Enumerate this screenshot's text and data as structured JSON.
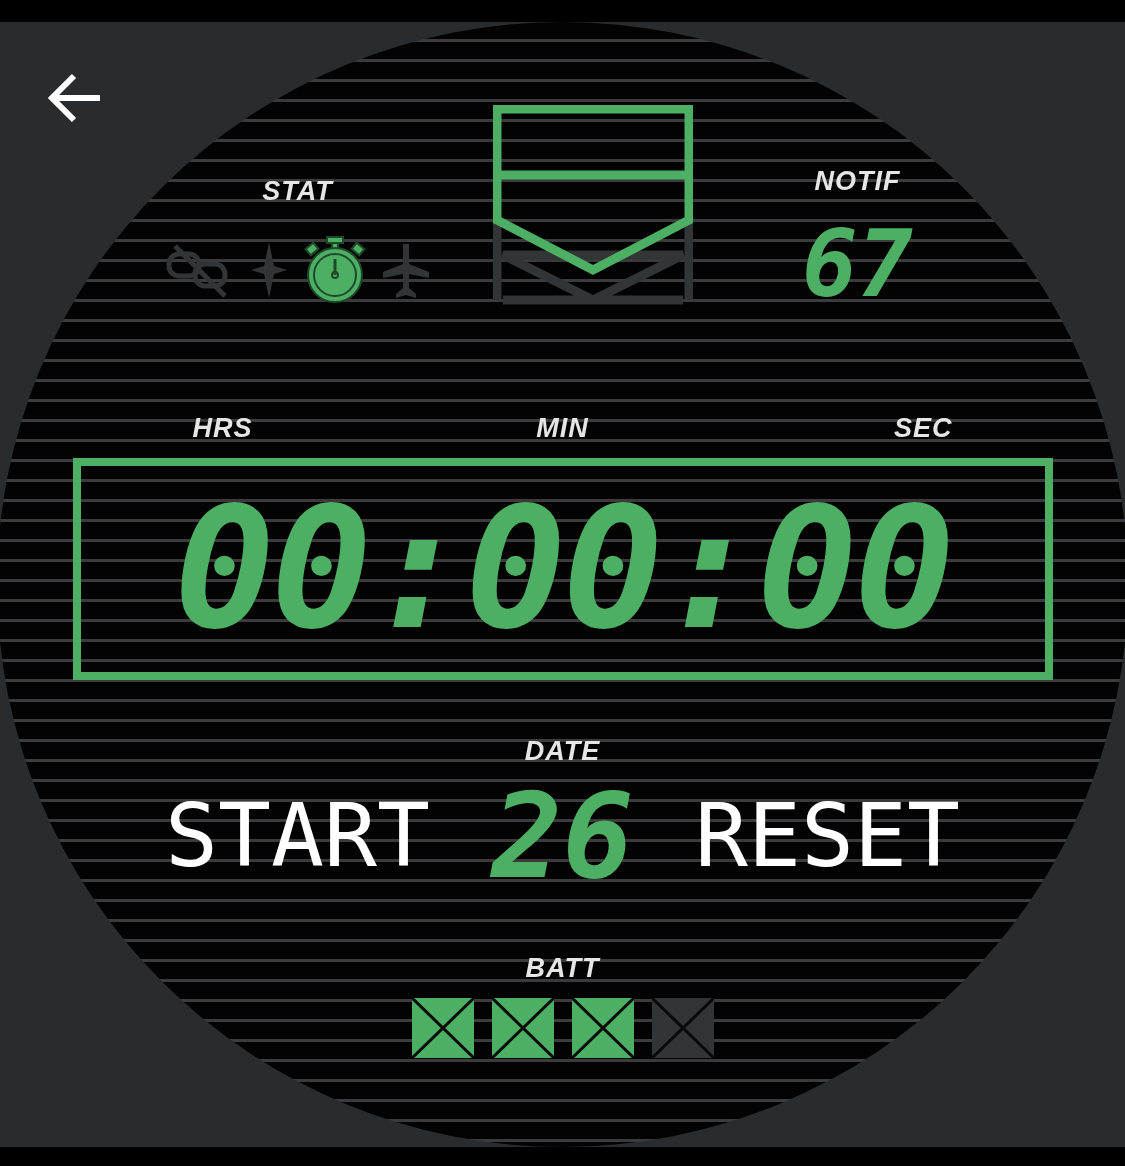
{
  "stat": {
    "label": "STAT",
    "icons": [
      {
        "kind": "link-off",
        "selected": false
      },
      {
        "kind": "spark",
        "selected": false
      },
      {
        "kind": "stopwatch",
        "selected": true
      },
      {
        "kind": "airplane",
        "selected": false
      }
    ]
  },
  "notif": {
    "label": "NOTIF",
    "count": "67"
  },
  "time_labels": [
    "HRS",
    "MIN",
    "SEC"
  ],
  "time": "00:00:00",
  "date": {
    "label": "DATE",
    "value": "26"
  },
  "buttons": [
    "START",
    "RESET"
  ],
  "battery": {
    "label": "BATT",
    "cells": [
      {
        "on": true
      },
      {
        "on": true
      },
      {
        "on": true
      },
      {
        "on": false
      }
    ]
  }
}
